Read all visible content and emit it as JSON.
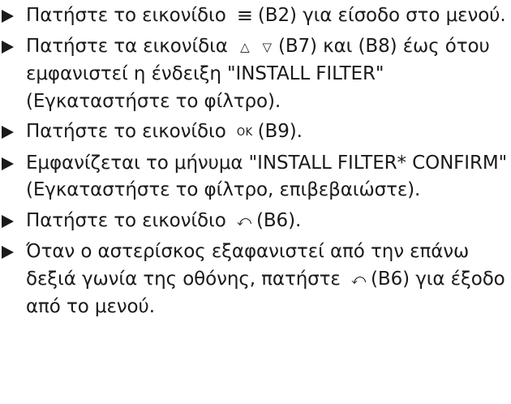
{
  "steps": [
    {
      "parts": [
        {
          "t": "text",
          "v": "Πατήστε το εικονίδιο"
        },
        {
          "t": "icon",
          "name": "menu-icon",
          "glyph": "≡",
          "cls": "ico-menu"
        },
        {
          "t": "text",
          "v": "(B2) για είσοδο στο μενού."
        }
      ]
    },
    {
      "parts": [
        {
          "t": "text",
          "v": "Πατήστε τα εικονίδια"
        },
        {
          "t": "icon",
          "name": "up-arrow-icon",
          "glyph": "△",
          "cls": "ico-up"
        },
        {
          "t": "icon",
          "name": "down-arrow-icon",
          "glyph": "▽",
          "cls": "ico-down"
        },
        {
          "t": "text",
          "v": "(B7) και (B8) έως ότου εμφανιστεί η ένδειξη \"INSTALL FILTER\" (Εγκαταστήστε το φίλτρο)."
        }
      ]
    },
    {
      "parts": [
        {
          "t": "text",
          "v": "Πατήστε το εικονίδιο"
        },
        {
          "t": "icon",
          "name": "ok-icon",
          "glyph": "OK",
          "cls": "ico-ok"
        },
        {
          "t": "text",
          "v": "(B9)."
        }
      ]
    },
    {
      "parts": [
        {
          "t": "text",
          "v": "Εμφανίζεται το μήνυμα \"INSTALL FILTER* CONFIRM\" (Εγκαταστήστε το φίλτρο, επιβεβαιώστε)."
        }
      ]
    },
    {
      "parts": [
        {
          "t": "text",
          "v": "Πατήστε το εικονίδιο"
        },
        {
          "t": "icon",
          "name": "back-icon",
          "glyph": "⤺",
          "cls": "ico-back"
        },
        {
          "t": "text",
          "v": "(B6)."
        }
      ]
    },
    {
      "parts": [
        {
          "t": "text",
          "v": "Όταν ο αστερίσκος εξαφανιστεί από την επάνω δεξιά γωνία της οθόνης, πατήστε"
        },
        {
          "t": "icon",
          "name": "back-icon",
          "glyph": "⤺",
          "cls": "ico-back"
        },
        {
          "t": "text",
          "v": "(B6) για έξοδο από το μενού."
        }
      ]
    }
  ]
}
